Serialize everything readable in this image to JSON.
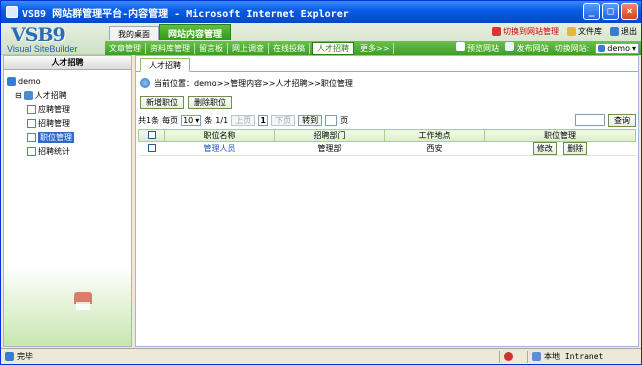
{
  "window": {
    "title": "VSB9 网站群管理平台-内容管理 - Microsoft Internet Explorer",
    "min": "_",
    "max": "□",
    "close": "×"
  },
  "logo": {
    "brand": "VSB9",
    "sub": "Visual SiteBuilder"
  },
  "tabs": {
    "desktop": "我的桌面",
    "content_mgmt": "网站内容管理"
  },
  "top_links": {
    "switch": "切换到网站管理",
    "library": "文件库",
    "exit": "退出"
  },
  "nav": {
    "items": [
      "文章管理",
      "资料库管理",
      "留言板",
      "网上调查",
      "在线投稿",
      "人才招聘",
      "更多>>"
    ],
    "active": "人才招聘",
    "preview": "预览网站",
    "publish": "发布网站",
    "switch_site": "切换网站:",
    "site_value": "demo"
  },
  "sidebar": {
    "title": "人才招聘",
    "tree": {
      "root": "demo",
      "group": "人才招聘",
      "children": [
        "应聘管理",
        "招聘管理",
        "职位管理",
        "招聘统计"
      ],
      "selected": "职位管理"
    }
  },
  "content": {
    "tab": "人才招聘",
    "breadcrumb": "当前位置：demo>>管理内容>>人才招聘>>职位管理",
    "add_button": "新增职位",
    "delete_button": "删除职位",
    "pager": {
      "total_label": "共1条",
      "per_page_label": "每页",
      "per_page_value": "10",
      "per_page_unit": "条",
      "page_info": "1/1",
      "prev": "上页",
      "current": "1",
      "next": "下页",
      "goto": "转到",
      "page_unit": "页",
      "search": "查询"
    },
    "table": {
      "headers": [
        "职位名称",
        "招聘部门",
        "工作地点",
        "职位管理"
      ],
      "rows": [
        {
          "name": "管理人员",
          "department": "管理部",
          "location": "西安",
          "edit": "修改",
          "delete": "删除"
        }
      ]
    }
  },
  "statusbar": {
    "left": "完毕",
    "zone": "本地 Intranet"
  }
}
